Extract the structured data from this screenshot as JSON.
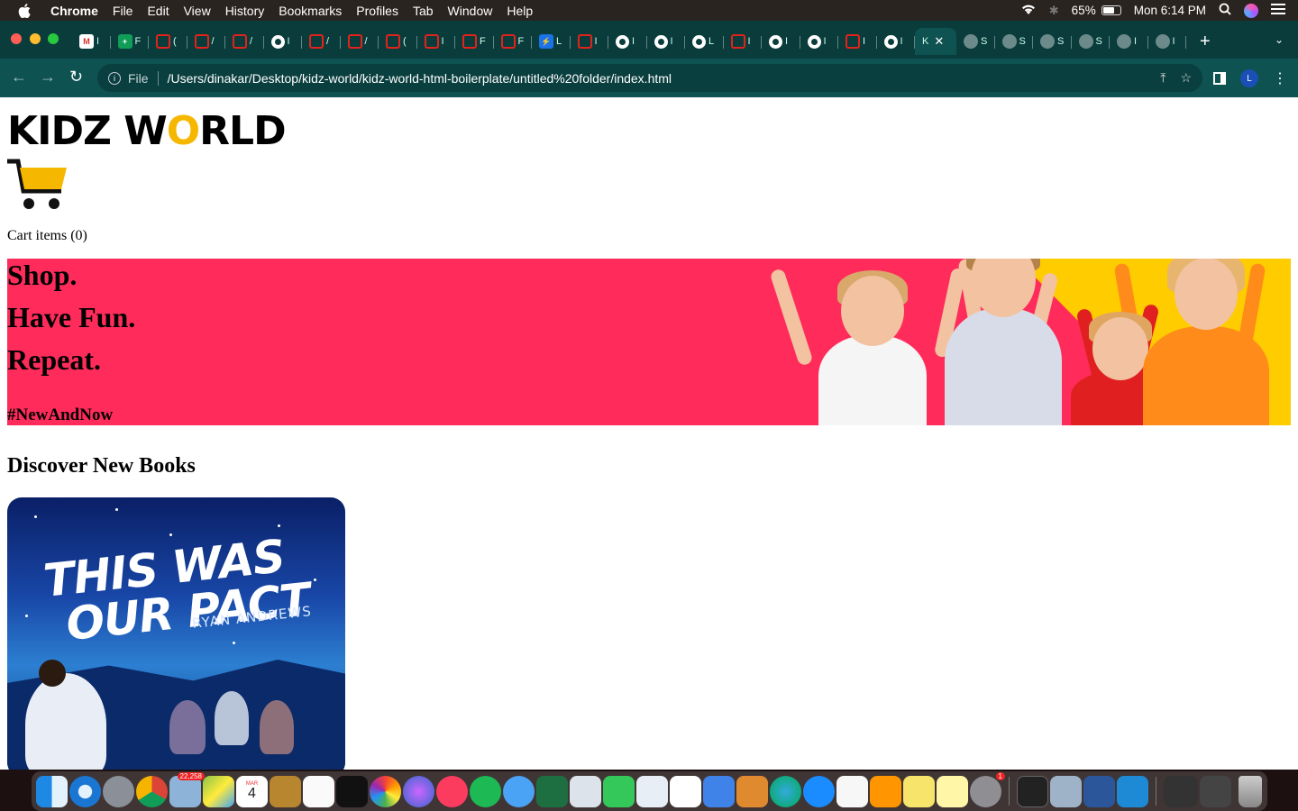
{
  "menubar": {
    "app": "Chrome",
    "items": [
      "File",
      "Edit",
      "View",
      "History",
      "Bookmarks",
      "Profiles",
      "Tab",
      "Window",
      "Help"
    ],
    "battery": "65%",
    "clock": "Mon 6:14 PM"
  },
  "tabs": {
    "items": [
      {
        "icon": "gmail-icon",
        "label": "I"
      },
      {
        "icon": "sheets-icon",
        "label": "F"
      },
      {
        "icon": "tab-red-icon",
        "label": "("
      },
      {
        "icon": "tab-red-icon",
        "label": "/"
      },
      {
        "icon": "tab-red-icon",
        "label": "/"
      },
      {
        "icon": "github-icon",
        "label": "I"
      },
      {
        "icon": "tab-red-icon",
        "label": "/"
      },
      {
        "icon": "tab-red-icon",
        "label": "/"
      },
      {
        "icon": "tab-red-icon",
        "label": "("
      },
      {
        "icon": "tab-red-icon",
        "label": "I"
      },
      {
        "icon": "tab-red-icon",
        "label": "F"
      },
      {
        "icon": "tab-red-icon",
        "label": "F"
      },
      {
        "icon": "bolt-icon",
        "label": "L"
      },
      {
        "icon": "tab-red-icon",
        "label": "I"
      },
      {
        "icon": "github-icon",
        "label": "I"
      },
      {
        "icon": "github-icon",
        "label": "I"
      },
      {
        "icon": "github-icon",
        "label": "L"
      },
      {
        "icon": "tab-red-icon",
        "label": "I"
      },
      {
        "icon": "github-icon",
        "label": "I"
      },
      {
        "icon": "github-icon",
        "label": "I"
      },
      {
        "icon": "tab-red-icon",
        "label": "I"
      },
      {
        "icon": "github-icon",
        "label": "I"
      }
    ],
    "active_label": "K",
    "after": [
      {
        "icon": "globe-icon",
        "label": "S"
      },
      {
        "icon": "globe-icon",
        "label": "S"
      },
      {
        "icon": "globe-icon",
        "label": "S"
      },
      {
        "icon": "globe-icon",
        "label": "S"
      },
      {
        "icon": "globe-icon",
        "label": "I"
      },
      {
        "icon": "globe-icon",
        "label": "I"
      }
    ],
    "new_tab": "+"
  },
  "address": {
    "scheme_label": "File",
    "url": "/Users/dinakar/Desktop/kidz-world/kidz-world-html-boilerplate/untitled%20folder/index.html",
    "profile_initial": "L"
  },
  "page": {
    "logo_part1": "KIDZ W",
    "logo_o": "O",
    "logo_part2": "RLD",
    "cart_label": "Cart items (0)",
    "hero": {
      "line1": "Shop.",
      "line2": "Have Fun.",
      "line3": "Repeat.",
      "tag": "#NewAndNow"
    },
    "section_title": "Discover New Books",
    "book": {
      "title_line1": "THIS WAS",
      "title_line2": "OUR PACT",
      "author": "RYAN ANDREWS"
    }
  },
  "dock": {
    "badge_photos": "22,258",
    "badge_prefs": "1",
    "calendar_day": "4",
    "calendar_month": "MAR"
  }
}
